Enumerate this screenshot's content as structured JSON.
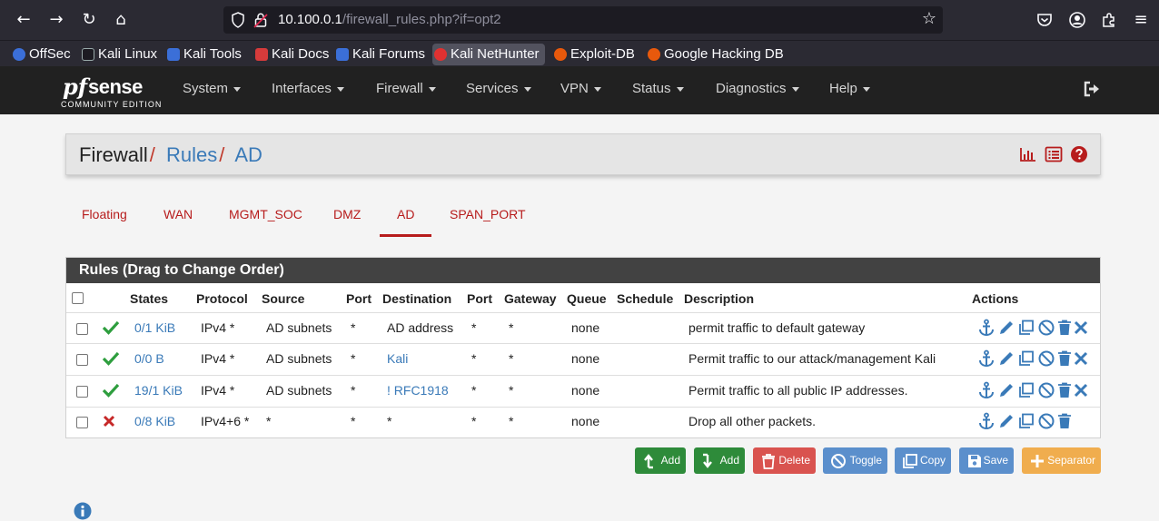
{
  "browser": {
    "url_host": "10.100.0.1",
    "url_path": "/firewall_rules.php?if=opt2",
    "bookmarks": [
      "OffSec",
      "Kali Linux",
      "Kali Tools",
      "Kali Docs",
      "Kali Forums",
      "Kali NetHunter",
      "Exploit-DB",
      "Google Hacking DB"
    ]
  },
  "logo": {
    "pf": "pf",
    "sense": "sense",
    "edition": "COMMUNITY EDITION"
  },
  "menu": [
    "System",
    "Interfaces",
    "Firewall",
    "Services",
    "VPN",
    "Status",
    "Diagnostics",
    "Help"
  ],
  "breadcrumb": {
    "root": "Firewall",
    "level1": "Rules",
    "level2": "AD"
  },
  "tabs": [
    "Floating",
    "WAN",
    "MGMT_SOC",
    "DMZ",
    "AD",
    "SPAN_PORT"
  ],
  "active_tab": "AD",
  "panel_title": "Rules (Drag to Change Order)",
  "columns": [
    "States",
    "Protocol",
    "Source",
    "Port",
    "Destination",
    "Port",
    "Gateway",
    "Queue",
    "Schedule",
    "Description",
    "Actions"
  ],
  "rules": [
    {
      "status": "pass",
      "states": "0/1 KiB",
      "protocol": "IPv4 *",
      "source": "AD subnets",
      "src_port": "*",
      "destination": "AD address",
      "dst_port": "*",
      "gateway": "*",
      "queue": "none",
      "schedule": "",
      "description": "permit traffic to default gateway"
    },
    {
      "status": "pass",
      "states": "0/0 B",
      "protocol": "IPv4 *",
      "source": "AD subnets",
      "src_port": "*",
      "destination": "Kali",
      "dst_port": "*",
      "gateway": "*",
      "queue": "none",
      "schedule": "",
      "description": "Permit traffic to our attack/management Kali"
    },
    {
      "status": "pass",
      "states": "19/1 KiB",
      "protocol": "IPv4 *",
      "source": "AD subnets",
      "src_port": "*",
      "destination": "! RFC1918",
      "dst_port": "*",
      "gateway": "*",
      "queue": "none",
      "schedule": "",
      "description": "Permit traffic to all public IP addresses."
    },
    {
      "status": "block",
      "states": "0/8 KiB",
      "protocol": "IPv4+6 *",
      "source": "*",
      "src_port": "*",
      "destination": "*",
      "dst_port": "*",
      "gateway": "*",
      "queue": "none",
      "schedule": "",
      "description": "Drop all other packets."
    }
  ],
  "buttons": {
    "add_top": "Add",
    "add_bottom": "Add",
    "delete": "Delete",
    "toggle": "Toggle",
    "copy": "Copy",
    "save": "Save",
    "separator": "Separator"
  },
  "colors": {
    "pass": "#2e9e3e",
    "block": "#c62828",
    "link": "#3a7ab8",
    "accent": "#b71c1c",
    "success_btn": "#2e8b3a",
    "danger_btn": "#d9534f",
    "info_btn": "#5b8fcc",
    "warning_btn": "#f0ad4e"
  }
}
